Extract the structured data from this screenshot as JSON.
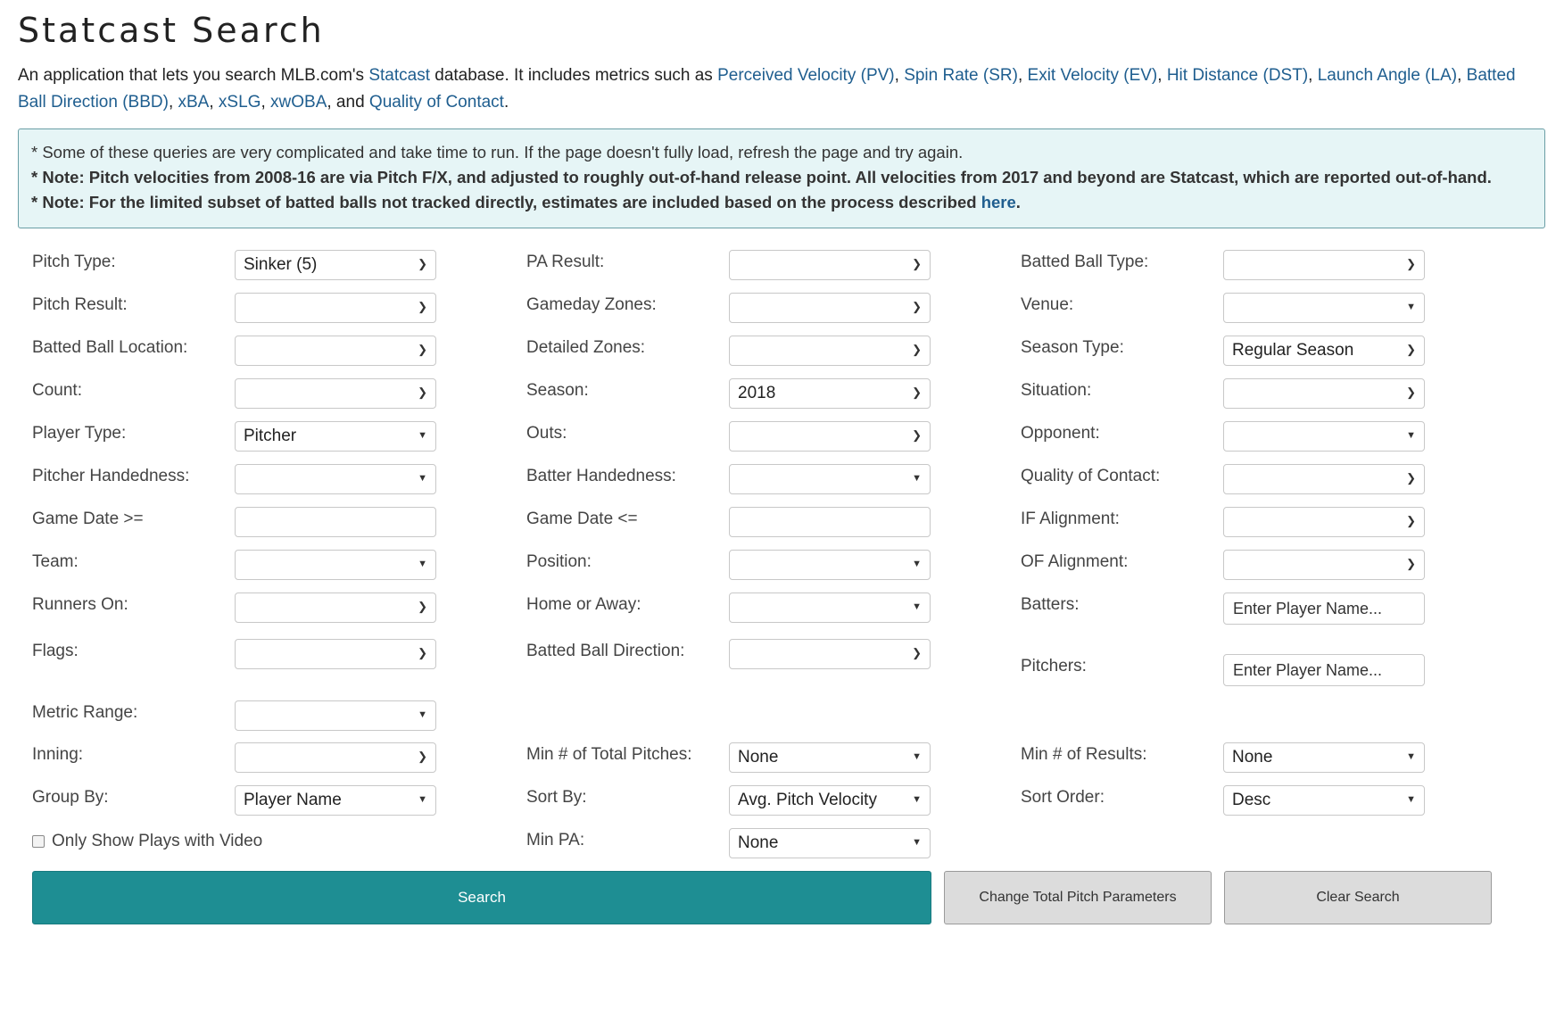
{
  "title": "Statcast Search",
  "intro": {
    "t0": "An application that lets you search MLB.com's ",
    "link_statcast": "Statcast",
    "t1": " database. It includes metrics such as ",
    "link_pv": "Perceived Velocity (PV)",
    "sep1": ", ",
    "link_sr": "Spin Rate (SR)",
    "sep2": ", ",
    "link_ev": "Exit Velocity (EV)",
    "sep3": ", ",
    "link_dst": "Hit Distance (DST)",
    "sep4": ", ",
    "link_la": "Launch Angle (LA)",
    "sep5": ", ",
    "link_bbd": "Batted Ball Direction (BBD)",
    "sep6": ", ",
    "link_xba": "xBA",
    "sep7": ", ",
    "link_xslg": "xSLG",
    "sep8": ", ",
    "link_xwoba": "xwOBA",
    "t2": ", and ",
    "link_qoc": "Quality of Contact",
    "t3": "."
  },
  "notes": {
    "line1": "* Some of these queries are very complicated and take time to run. If the page doesn't fully load, refresh the page and try again.",
    "line2": "* Note: Pitch velocities from 2008-16 are via Pitch F/X, and adjusted to roughly out-of-hand release point. All velocities from 2017 and beyond are Statcast, which are reported out-of-hand.",
    "line3_text": "* Note: For the limited subset of batted balls not tracked directly, estimates are included based on the process described ",
    "line3_link": "here",
    "line3_end": "."
  },
  "arrow_glyph": "❯",
  "small_arrow_glyph": "▼",
  "form": {
    "pitch_type": {
      "label": "Pitch Type:",
      "value": "Sinker (5)"
    },
    "pitch_result": {
      "label": "Pitch Result:",
      "value": ""
    },
    "batted_ball_location": {
      "label": "Batted Ball Location:",
      "value": ""
    },
    "count": {
      "label": "Count:",
      "value": ""
    },
    "player_type": {
      "label": "Player Type:",
      "value": "Pitcher"
    },
    "pitcher_handedness": {
      "label": "Pitcher Handedness:",
      "value": ""
    },
    "game_date_gte": {
      "label": "Game Date >=",
      "value": ""
    },
    "team": {
      "label": "Team:",
      "value": ""
    },
    "runners_on": {
      "label": "Runners On:",
      "value": ""
    },
    "flags": {
      "label": "Flags:",
      "value": ""
    },
    "metric_range": {
      "label": "Metric Range:",
      "value": ""
    },
    "inning": {
      "label": "Inning:",
      "value": ""
    },
    "group_by": {
      "label": "Group By:",
      "value": "Player Name"
    },
    "only_video": {
      "label": "Only Show Plays with Video",
      "checked": false
    },
    "pa_result": {
      "label": "PA Result:",
      "value": ""
    },
    "gameday_zones": {
      "label": "Gameday Zones:",
      "value": ""
    },
    "detailed_zones": {
      "label": "Detailed Zones:",
      "value": ""
    },
    "season": {
      "label": "Season:",
      "value": "2018"
    },
    "outs": {
      "label": "Outs:",
      "value": ""
    },
    "batter_handedness": {
      "label": "Batter Handedness:",
      "value": ""
    },
    "game_date_lte": {
      "label": "Game Date <=",
      "value": ""
    },
    "position": {
      "label": "Position:",
      "value": ""
    },
    "home_or_away": {
      "label": "Home or Away:",
      "value": ""
    },
    "batted_ball_direction": {
      "label": "Batted Ball Direction:",
      "value": ""
    },
    "min_total_pitches": {
      "label": "Min # of Total Pitches:",
      "value": "None"
    },
    "sort_by": {
      "label": "Sort By:",
      "value": "Avg. Pitch Velocity"
    },
    "min_pa": {
      "label": "Min PA:",
      "value": "None"
    },
    "batted_ball_type": {
      "label": "Batted Ball Type:",
      "value": ""
    },
    "venue": {
      "label": "Venue:",
      "value": ""
    },
    "season_type": {
      "label": "Season Type:",
      "value": "Regular Season"
    },
    "situation": {
      "label": "Situation:",
      "value": ""
    },
    "opponent": {
      "label": "Opponent:",
      "value": ""
    },
    "quality_of_contact": {
      "label": "Quality of Contact:",
      "value": ""
    },
    "if_alignment": {
      "label": "IF Alignment:",
      "value": ""
    },
    "of_alignment": {
      "label": "OF Alignment:",
      "value": ""
    },
    "batters": {
      "label": "Batters:",
      "placeholder": "Enter Player Name..."
    },
    "pitchers": {
      "label": "Pitchers:",
      "placeholder": "Enter Player Name..."
    },
    "min_results": {
      "label": "Min # of Results:",
      "value": "None"
    },
    "sort_order": {
      "label": "Sort Order:",
      "value": "Desc"
    }
  },
  "buttons": {
    "search": "Search",
    "change_total_pitch": "Change Total Pitch Parameters",
    "clear_search": "Clear Search"
  },
  "colors": {
    "link": "#1f5e8f",
    "primary": "#1e8e93",
    "notes_bg": "#e6f5f6"
  }
}
